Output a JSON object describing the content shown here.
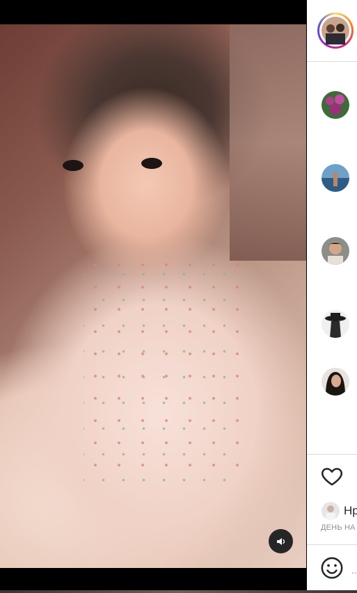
{
  "video": {
    "description_icon": "speaker-icon"
  },
  "sidebar": {
    "story_avatar_icon": "story-avatar-icon",
    "suggested": [
      {
        "icon": "flowers-avatar"
      },
      {
        "icon": "beach-avatar"
      },
      {
        "icon": "woman-avatar"
      },
      {
        "icon": "hat-avatar"
      },
      {
        "icon": "dark-hair-avatar"
      }
    ]
  },
  "post": {
    "liked_by_name": "Нр",
    "date_text": "ДЕНЬ НА",
    "comment_placeholder": "..."
  },
  "colors": {
    "panel_bg": "#ffffff",
    "divider": "#dbdbdb",
    "muted_text": "#8e8e8e",
    "primary_text": "#262626"
  }
}
